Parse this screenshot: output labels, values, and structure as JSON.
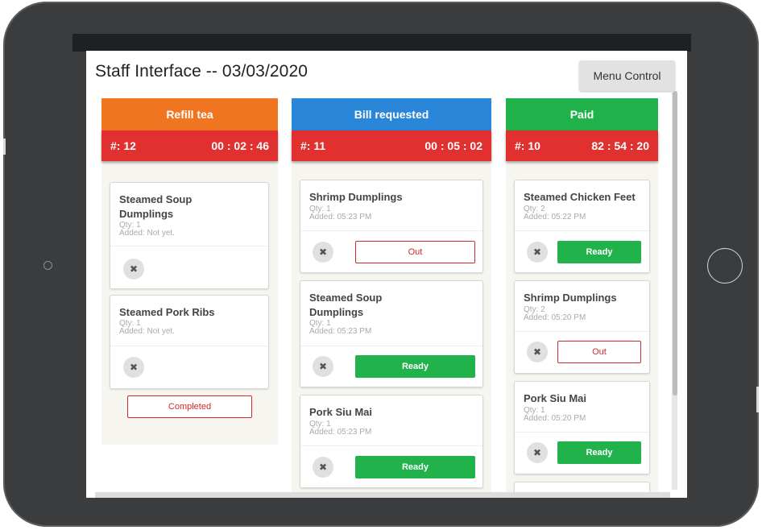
{
  "page": {
    "title": "Staff Interface -- 03/03/2020",
    "menu_control_label": "Menu Control"
  },
  "colors": {
    "refill": "#f07520",
    "bill": "#2a86d8",
    "paid": "#22b24c",
    "timer_bar": "#e03030",
    "ready": "#22b24c",
    "out": "#d02a2a"
  },
  "columns": [
    {
      "status": "Refill tea",
      "table": "#: 12",
      "timer": "00 : 02 : 46",
      "items": [
        {
          "name": "Steamed Soup Dumplings",
          "qty": "Qty: 1",
          "added": "Added: Not yet."
        },
        {
          "name": "Steamed Pork Ribs",
          "qty": "Qty: 1",
          "added": "Added: Not yet."
        }
      ],
      "completed_label": "Completed"
    },
    {
      "status": "Bill requested",
      "table": "#: 11",
      "timer": "00 : 05 : 02",
      "items": [
        {
          "name": "Shrimp Dumplings",
          "qty": "Qty: 1",
          "added": "Added: 05:23 PM",
          "action": "Out"
        },
        {
          "name": "Steamed Soup Dumplings",
          "qty": "Qty: 1",
          "added": "Added: 05:23 PM",
          "action": "Ready"
        },
        {
          "name": "Pork Siu Mai",
          "qty": "Qty: 1",
          "added": "Added: 05:23 PM",
          "action": "Ready"
        }
      ]
    },
    {
      "status": "Paid",
      "table": "#: 10",
      "timer": "82 : 54 : 20",
      "items": [
        {
          "name": "Steamed Chicken Feet",
          "qty": "Qty: 2",
          "added": "Added: 05:22 PM",
          "action": "Ready"
        },
        {
          "name": "Shrimp Dumplings",
          "qty": "Qty: 2",
          "added": "Added: 05:20 PM",
          "action": "Out"
        },
        {
          "name": "Pork Siu Mai",
          "qty": "Qty: 1",
          "added": "Added: 05:20 PM",
          "action": "Ready"
        }
      ]
    }
  ],
  "icons": {
    "remove": "✖"
  }
}
